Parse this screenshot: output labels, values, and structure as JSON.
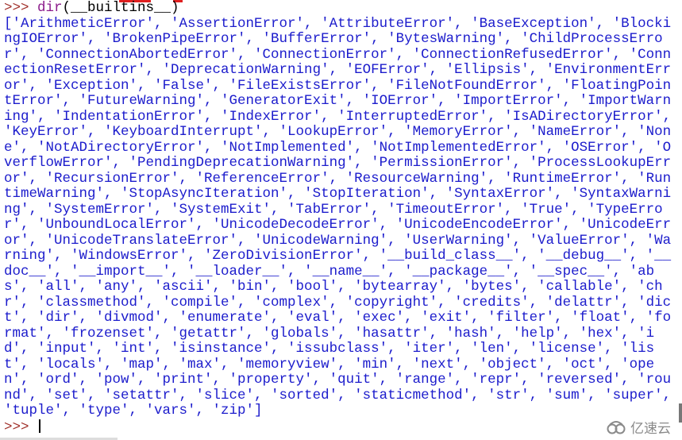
{
  "colors": {
    "prompt": "#a0302a",
    "command": "#8b1a8b",
    "output": "#1c1ccc",
    "accent_red": "#e02020"
  },
  "shell": {
    "prompt": ">>> ",
    "command_func": "dir",
    "command_args": "(__builtins__)",
    "output": "['ArithmeticError', 'AssertionError', 'AttributeError', 'BaseException', 'BlockingIOError', 'BrokenPipeError', 'BufferError', 'BytesWarning', 'ChildProcessError', 'ConnectionAbortedError', 'ConnectionError', 'ConnectionRefusedError', 'ConnectionResetError', 'DeprecationWarning', 'EOFError', 'Ellipsis', 'EnvironmentError', 'Exception', 'False', 'FileExistsError', 'FileNotFoundError', 'FloatingPointError', 'FutureWarning', 'GeneratorExit', 'IOError', 'ImportError', 'ImportWarning', 'IndentationError', 'IndexError', 'InterruptedError', 'IsADirectoryError', 'KeyError', 'KeyboardInterrupt', 'LookupError', 'MemoryError', 'NameError', 'None', 'NotADirectoryError', 'NotImplemented', 'NotImplementedError', 'OSError', 'OverflowError', 'PendingDeprecationWarning', 'PermissionError', 'ProcessLookupError', 'RecursionError', 'ReferenceError', 'ResourceWarning', 'RuntimeError', 'RuntimeWarning', 'StopAsyncIteration', 'StopIteration', 'SyntaxError', 'SyntaxWarning', 'SystemError', 'SystemExit', 'TabError', 'TimeoutError', 'True', 'TypeError', 'UnboundLocalError', 'UnicodeDecodeError', 'UnicodeEncodeError', 'UnicodeError', 'UnicodeTranslateError', 'UnicodeWarning', 'UserWarning', 'ValueError', 'Warning', 'WindowsError', 'ZeroDivisionError', '__build_class__', '__debug__', '__doc__', '__import__', '__loader__', '__name__', '__package__', '__spec__', 'abs', 'all', 'any', 'ascii', 'bin', 'bool', 'bytearray', 'bytes', 'callable', 'chr', 'classmethod', 'compile', 'complex', 'copyright', 'credits', 'delattr', 'dict', 'dir', 'divmod', 'enumerate', 'eval', 'exec', 'exit', 'filter', 'float', 'format', 'frozenset', 'getattr', 'globals', 'hasattr', 'hash', 'help', 'hex', 'id', 'input', 'int', 'isinstance', 'issubclass', 'iter', 'len', 'license', 'list', 'locals', 'map', 'max', 'memoryview', 'min', 'next', 'object', 'oct', 'open', 'ord', 'pow', 'print', 'property', 'quit', 'range', 'repr', 'reversed', 'round', 'set', 'setattr', 'slice', 'sorted', 'staticmethod', 'str', 'sum', 'super', 'tuple', 'type', 'vars', 'zip']",
    "final_prompt": ">>> "
  },
  "watermark": {
    "text": "亿速云",
    "icon": "cloud-logo-icon"
  }
}
